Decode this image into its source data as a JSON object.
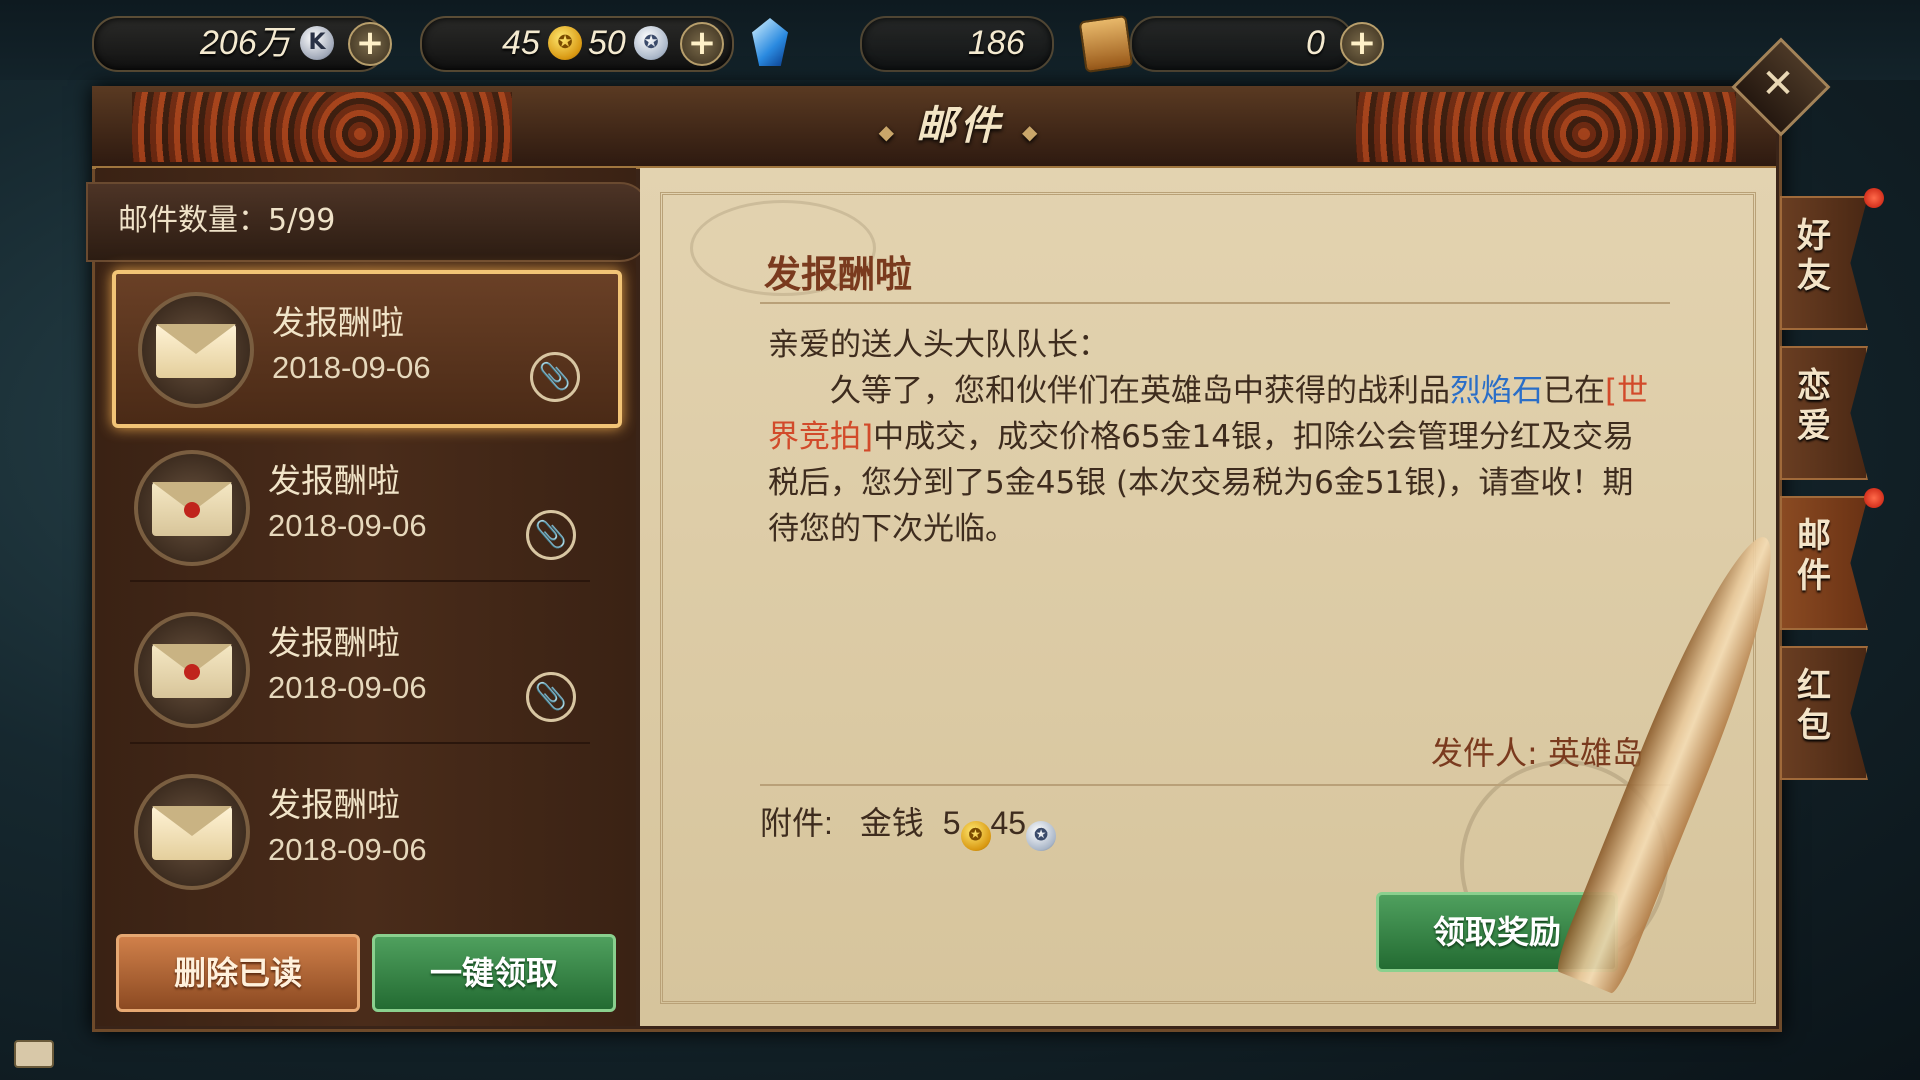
{
  "topbar": {
    "resources": [
      {
        "name": "k-coin",
        "value": "206万",
        "icon": "k-coin-icon"
      },
      {
        "name": "gold-silver",
        "gold": "45",
        "silver": "50"
      },
      {
        "name": "crystal",
        "icon": "blue-crystal-icon"
      },
      {
        "name": "tickets",
        "value": "186"
      },
      {
        "name": "scroll",
        "value": "0",
        "icon": "scroll-icon"
      }
    ],
    "plus_label": "+"
  },
  "window": {
    "title": "邮件",
    "close_label": "✕"
  },
  "mail_list": {
    "count_label": "邮件数量：5/99",
    "items": [
      {
        "title": "发报酬啦",
        "date": "2018-09-06",
        "has_attachment": true,
        "selected": true,
        "opened": true
      },
      {
        "title": "发报酬啦",
        "date": "2018-09-06",
        "has_attachment": true,
        "selected": false,
        "opened": false
      },
      {
        "title": "发报酬啦",
        "date": "2018-09-06",
        "has_attachment": true,
        "selected": false,
        "opened": false
      },
      {
        "title": "发报酬啦",
        "date": "2018-09-06",
        "has_attachment": false,
        "selected": false,
        "opened": true
      }
    ],
    "delete_read_label": "删除已读",
    "claim_all_label": "一键领取"
  },
  "letter": {
    "subject": "发报酬啦",
    "greeting": "亲爱的送人头大队队长：",
    "body_p1": "久等了，您和伙伴们在英雄岛中获得的战利品",
    "item_name": "烈焰石",
    "body_p2": "已在",
    "market_name": "[世界竞拍]",
    "body_p3": "中成交，成交价格65金14银，扣除公会管理分红及交易税后，您分到了5金45银 (本次交易税为6金51银)，请查收！期待您的下次光临。",
    "sender": "发件人: 英雄岛",
    "attachment_label": "附件:",
    "attachment_type": "金钱",
    "attachment_gold": "5",
    "attachment_silver": "45",
    "claim_label": "领取奖励"
  },
  "side_tabs": [
    {
      "label": "好\n友",
      "has_dot": true,
      "active": false
    },
    {
      "label": "恋\n爱",
      "has_dot": false,
      "active": false
    },
    {
      "label": "邮\n件",
      "has_dot": true,
      "active": true
    },
    {
      "label": "红\n包",
      "has_dot": false,
      "active": false
    }
  ],
  "colors": {
    "link_blue": "#2a6ec8",
    "market_red": "#d24a2a",
    "claim_green": "#2f7f3e",
    "delete_orange": "#b0602e"
  }
}
